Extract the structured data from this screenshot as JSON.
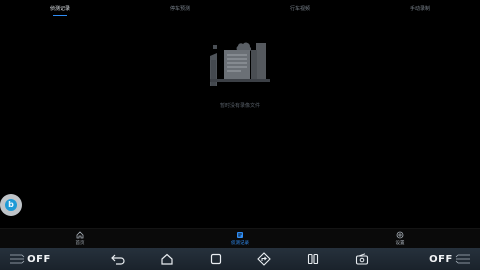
{
  "tabs": [
    {
      "label": "侦测记录",
      "active": true
    },
    {
      "label": "停车预测",
      "active": false
    },
    {
      "label": "行车视频",
      "active": false
    },
    {
      "label": "手动录制",
      "active": false
    }
  ],
  "empty_state": {
    "message": "暂时没有录像文件",
    "icon": "empty-city-document-icon"
  },
  "assistant_button": {
    "icon": "assistant-bubble-icon",
    "glyph": "b"
  },
  "app_nav": [
    {
      "label": "首页",
      "icon": "home-icon",
      "active": false
    },
    {
      "label": "侦测记录",
      "icon": "record-icon",
      "active": true
    },
    {
      "label": "设置",
      "icon": "settings-icon",
      "active": false
    }
  ],
  "system_bar": {
    "left_climate": "OFF",
    "right_climate": "OFF",
    "buttons": [
      "back-icon",
      "home-icon",
      "recents-icon",
      "navigation-icon",
      "split-screen-icon",
      "radio-icon"
    ]
  },
  "colors": {
    "accent": "#2f8df5",
    "background": "#000000",
    "system_bar": "#1f2831",
    "assistant": "#1e9ad6"
  }
}
